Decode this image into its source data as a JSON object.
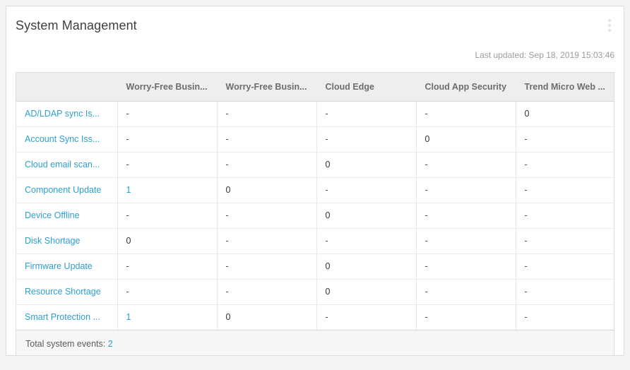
{
  "widget": {
    "title": "System Management",
    "menu_icon": "kebab-menu-icon",
    "last_updated": "Last updated: Sep 18, 2019 15:03:46"
  },
  "table": {
    "columns": [
      "",
      "Worry-Free Busin...",
      "Worry-Free Busin...",
      "Cloud Edge",
      "Cloud App Security",
      "Trend Micro Web ..."
    ],
    "rows": [
      {
        "label": "AD/LDAP sync Is...",
        "values": [
          "-",
          "-",
          "-",
          "-",
          "0"
        ]
      },
      {
        "label": "Account Sync Iss...",
        "values": [
          "-",
          "-",
          "-",
          "0",
          "-"
        ]
      },
      {
        "label": "Cloud email scan...",
        "values": [
          "-",
          "-",
          "0",
          "-",
          "-"
        ]
      },
      {
        "label": "Component Update",
        "values": [
          "1",
          "0",
          "-",
          "-",
          "-"
        ]
      },
      {
        "label": "Device Offline",
        "values": [
          "-",
          "-",
          "0",
          "-",
          "-"
        ]
      },
      {
        "label": "Disk Shortage",
        "values": [
          "0",
          "-",
          "-",
          "-",
          "-"
        ]
      },
      {
        "label": "Firmware Update",
        "values": [
          "-",
          "-",
          "0",
          "-",
          "-"
        ]
      },
      {
        "label": "Resource Shortage",
        "values": [
          "-",
          "-",
          "0",
          "-",
          "-"
        ]
      },
      {
        "label": "Smart Protection ...",
        "values": [
          "1",
          "0",
          "-",
          "-",
          "-"
        ]
      }
    ],
    "footer": {
      "label": "Total system events:",
      "count": "2"
    }
  },
  "colors": {
    "link": "#2f9fd0",
    "header_bg": "#eeeeee",
    "footer_bg": "#f7f7f7",
    "title_text": "#404040",
    "muted_text": "#9b9b9b"
  }
}
